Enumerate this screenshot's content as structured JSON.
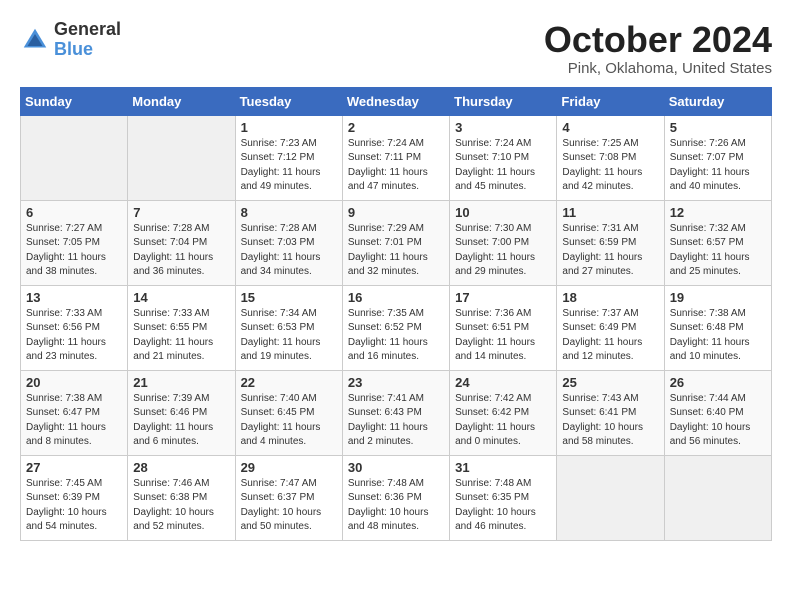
{
  "header": {
    "logo_general": "General",
    "logo_blue": "Blue",
    "title": "October 2024",
    "subtitle": "Pink, Oklahoma, United States"
  },
  "weekdays": [
    "Sunday",
    "Monday",
    "Tuesday",
    "Wednesday",
    "Thursday",
    "Friday",
    "Saturday"
  ],
  "weeks": [
    [
      {
        "day": "",
        "sunrise": "",
        "sunset": "",
        "daylight": "",
        "empty": true
      },
      {
        "day": "",
        "sunrise": "",
        "sunset": "",
        "daylight": "",
        "empty": true
      },
      {
        "day": "1",
        "sunrise": "Sunrise: 7:23 AM",
        "sunset": "Sunset: 7:12 PM",
        "daylight": "Daylight: 11 hours and 49 minutes."
      },
      {
        "day": "2",
        "sunrise": "Sunrise: 7:24 AM",
        "sunset": "Sunset: 7:11 PM",
        "daylight": "Daylight: 11 hours and 47 minutes."
      },
      {
        "day": "3",
        "sunrise": "Sunrise: 7:24 AM",
        "sunset": "Sunset: 7:10 PM",
        "daylight": "Daylight: 11 hours and 45 minutes."
      },
      {
        "day": "4",
        "sunrise": "Sunrise: 7:25 AM",
        "sunset": "Sunset: 7:08 PM",
        "daylight": "Daylight: 11 hours and 42 minutes."
      },
      {
        "day": "5",
        "sunrise": "Sunrise: 7:26 AM",
        "sunset": "Sunset: 7:07 PM",
        "daylight": "Daylight: 11 hours and 40 minutes."
      }
    ],
    [
      {
        "day": "6",
        "sunrise": "Sunrise: 7:27 AM",
        "sunset": "Sunset: 7:05 PM",
        "daylight": "Daylight: 11 hours and 38 minutes."
      },
      {
        "day": "7",
        "sunrise": "Sunrise: 7:28 AM",
        "sunset": "Sunset: 7:04 PM",
        "daylight": "Daylight: 11 hours and 36 minutes."
      },
      {
        "day": "8",
        "sunrise": "Sunrise: 7:28 AM",
        "sunset": "Sunset: 7:03 PM",
        "daylight": "Daylight: 11 hours and 34 minutes."
      },
      {
        "day": "9",
        "sunrise": "Sunrise: 7:29 AM",
        "sunset": "Sunset: 7:01 PM",
        "daylight": "Daylight: 11 hours and 32 minutes."
      },
      {
        "day": "10",
        "sunrise": "Sunrise: 7:30 AM",
        "sunset": "Sunset: 7:00 PM",
        "daylight": "Daylight: 11 hours and 29 minutes."
      },
      {
        "day": "11",
        "sunrise": "Sunrise: 7:31 AM",
        "sunset": "Sunset: 6:59 PM",
        "daylight": "Daylight: 11 hours and 27 minutes."
      },
      {
        "day": "12",
        "sunrise": "Sunrise: 7:32 AM",
        "sunset": "Sunset: 6:57 PM",
        "daylight": "Daylight: 11 hours and 25 minutes."
      }
    ],
    [
      {
        "day": "13",
        "sunrise": "Sunrise: 7:33 AM",
        "sunset": "Sunset: 6:56 PM",
        "daylight": "Daylight: 11 hours and 23 minutes."
      },
      {
        "day": "14",
        "sunrise": "Sunrise: 7:33 AM",
        "sunset": "Sunset: 6:55 PM",
        "daylight": "Daylight: 11 hours and 21 minutes."
      },
      {
        "day": "15",
        "sunrise": "Sunrise: 7:34 AM",
        "sunset": "Sunset: 6:53 PM",
        "daylight": "Daylight: 11 hours and 19 minutes."
      },
      {
        "day": "16",
        "sunrise": "Sunrise: 7:35 AM",
        "sunset": "Sunset: 6:52 PM",
        "daylight": "Daylight: 11 hours and 16 minutes."
      },
      {
        "day": "17",
        "sunrise": "Sunrise: 7:36 AM",
        "sunset": "Sunset: 6:51 PM",
        "daylight": "Daylight: 11 hours and 14 minutes."
      },
      {
        "day": "18",
        "sunrise": "Sunrise: 7:37 AM",
        "sunset": "Sunset: 6:49 PM",
        "daylight": "Daylight: 11 hours and 12 minutes."
      },
      {
        "day": "19",
        "sunrise": "Sunrise: 7:38 AM",
        "sunset": "Sunset: 6:48 PM",
        "daylight": "Daylight: 11 hours and 10 minutes."
      }
    ],
    [
      {
        "day": "20",
        "sunrise": "Sunrise: 7:38 AM",
        "sunset": "Sunset: 6:47 PM",
        "daylight": "Daylight: 11 hours and 8 minutes."
      },
      {
        "day": "21",
        "sunrise": "Sunrise: 7:39 AM",
        "sunset": "Sunset: 6:46 PM",
        "daylight": "Daylight: 11 hours and 6 minutes."
      },
      {
        "day": "22",
        "sunrise": "Sunrise: 7:40 AM",
        "sunset": "Sunset: 6:45 PM",
        "daylight": "Daylight: 11 hours and 4 minutes."
      },
      {
        "day": "23",
        "sunrise": "Sunrise: 7:41 AM",
        "sunset": "Sunset: 6:43 PM",
        "daylight": "Daylight: 11 hours and 2 minutes."
      },
      {
        "day": "24",
        "sunrise": "Sunrise: 7:42 AM",
        "sunset": "Sunset: 6:42 PM",
        "daylight": "Daylight: 11 hours and 0 minutes."
      },
      {
        "day": "25",
        "sunrise": "Sunrise: 7:43 AM",
        "sunset": "Sunset: 6:41 PM",
        "daylight": "Daylight: 10 hours and 58 minutes."
      },
      {
        "day": "26",
        "sunrise": "Sunrise: 7:44 AM",
        "sunset": "Sunset: 6:40 PM",
        "daylight": "Daylight: 10 hours and 56 minutes."
      }
    ],
    [
      {
        "day": "27",
        "sunrise": "Sunrise: 7:45 AM",
        "sunset": "Sunset: 6:39 PM",
        "daylight": "Daylight: 10 hours and 54 minutes."
      },
      {
        "day": "28",
        "sunrise": "Sunrise: 7:46 AM",
        "sunset": "Sunset: 6:38 PM",
        "daylight": "Daylight: 10 hours and 52 minutes."
      },
      {
        "day": "29",
        "sunrise": "Sunrise: 7:47 AM",
        "sunset": "Sunset: 6:37 PM",
        "daylight": "Daylight: 10 hours and 50 minutes."
      },
      {
        "day": "30",
        "sunrise": "Sunrise: 7:48 AM",
        "sunset": "Sunset: 6:36 PM",
        "daylight": "Daylight: 10 hours and 48 minutes."
      },
      {
        "day": "31",
        "sunrise": "Sunrise: 7:48 AM",
        "sunset": "Sunset: 6:35 PM",
        "daylight": "Daylight: 10 hours and 46 minutes."
      },
      {
        "day": "",
        "sunrise": "",
        "sunset": "",
        "daylight": "",
        "empty": true
      },
      {
        "day": "",
        "sunrise": "",
        "sunset": "",
        "daylight": "",
        "empty": true
      }
    ]
  ]
}
